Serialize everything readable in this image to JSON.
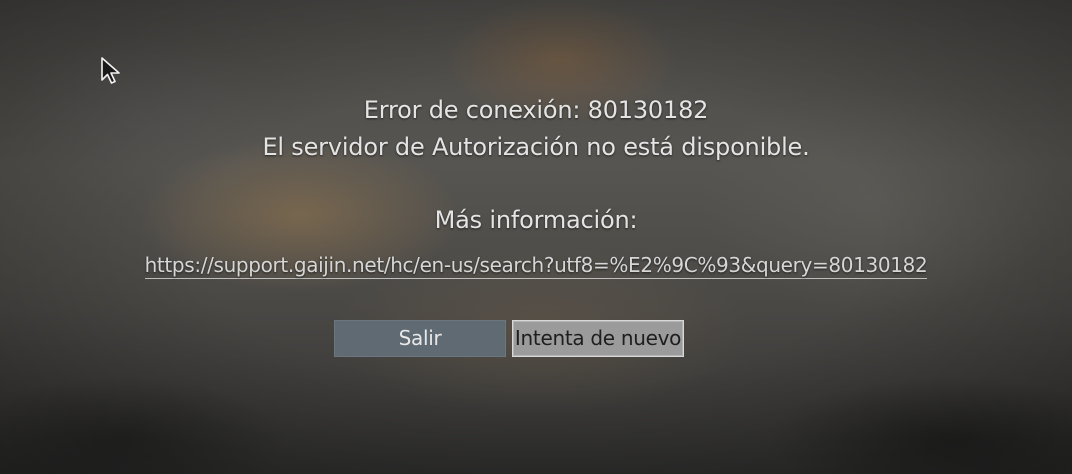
{
  "dialog": {
    "error_line": "Error de conexión: 80130182",
    "message_line": "El servidor de Autorización no está disponible.",
    "more_info_label": "Más información:",
    "link_text": "https://support.gaijin.net/hc/en-us/search?utf8=%E2%9C%93&query=80130182"
  },
  "buttons": {
    "exit_label": "Salir",
    "retry_label": "Intenta de nuevo"
  },
  "colors": {
    "text": "#e4e4e4",
    "exit_button_bg": "#5f6a73",
    "retry_button_bg": "#9b9b9b",
    "retry_button_border": "#d8d8d8"
  },
  "icons": {
    "cursor": "mouse-pointer-icon"
  }
}
